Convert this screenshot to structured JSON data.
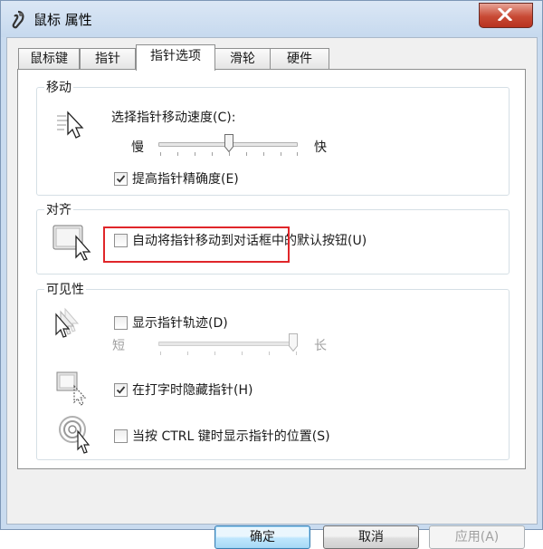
{
  "window": {
    "title": "鼠标 属性",
    "close_icon": "close-icon"
  },
  "tabs": [
    {
      "label": "鼠标键",
      "active": false
    },
    {
      "label": "指针",
      "active": false
    },
    {
      "label": "指针选项",
      "active": true
    },
    {
      "label": "滑轮",
      "active": false
    },
    {
      "label": "硬件",
      "active": false
    }
  ],
  "motion": {
    "title": "移动",
    "speed_label": "选择指针移动速度(C):",
    "slow": "慢",
    "fast": "快",
    "speed_level": 0.5,
    "precision_label": "提高指针精确度(E)",
    "precision_checked": true
  },
  "snap": {
    "title": "对齐",
    "label": "自动将指针移动到对话框中的默认按钮(U)",
    "checked": false
  },
  "visibility": {
    "title": "可见性",
    "trails_label": "显示指针轨迹(D)",
    "trails_checked": false,
    "trails_short": "短",
    "trails_long": "长",
    "trails_level": 1.0,
    "hide_label": "在打字时隐藏指针(H)",
    "hide_checked": true,
    "ctrl_label": "当按 CTRL 键时显示指针的位置(S)",
    "ctrl_checked": false
  },
  "buttons": {
    "ok": "确定",
    "cancel": "取消",
    "apply": "应用(A)"
  },
  "colors": {
    "highlight_box": "#e0262a",
    "accent": "#3c7fb1"
  }
}
